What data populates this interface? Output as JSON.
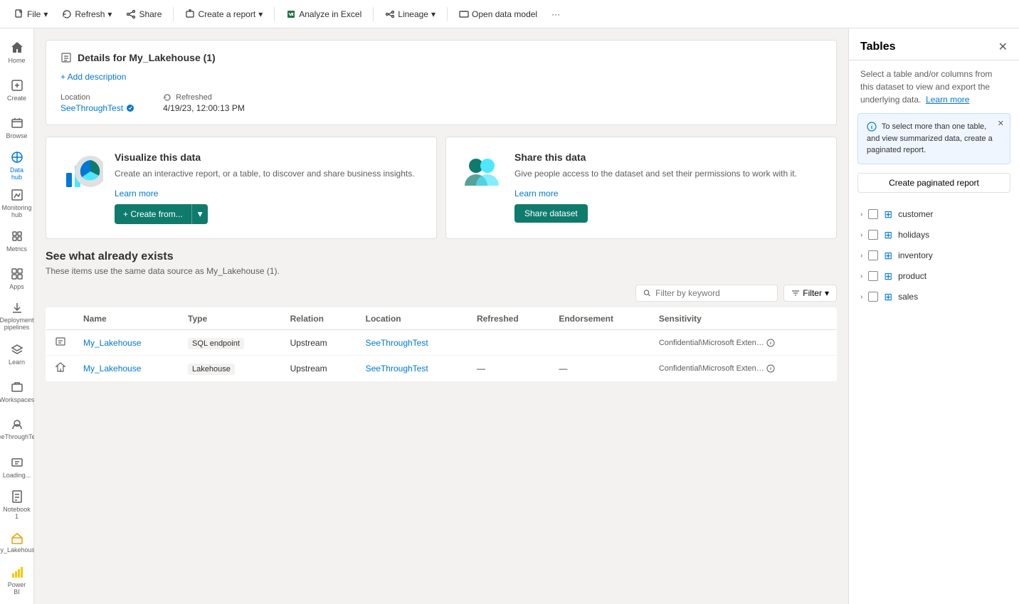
{
  "toolbar": {
    "file_label": "File",
    "refresh_label": "Refresh",
    "share_label": "Share",
    "create_report_label": "Create a report",
    "analyze_excel_label": "Analyze in Excel",
    "lineage_label": "Lineage",
    "open_data_model_label": "Open data model",
    "more_label": "···"
  },
  "sidebar": {
    "items": [
      {
        "id": "home",
        "label": "Home"
      },
      {
        "id": "create",
        "label": "Create"
      },
      {
        "id": "browse",
        "label": "Browse"
      },
      {
        "id": "datahub",
        "label": "Data hub",
        "active": true
      },
      {
        "id": "monitoring",
        "label": "Monitoring hub"
      },
      {
        "id": "metrics",
        "label": "Metrics"
      },
      {
        "id": "apps",
        "label": "Apps"
      },
      {
        "id": "deployment",
        "label": "Deployment pipelines"
      },
      {
        "id": "learn",
        "label": "Learn"
      },
      {
        "id": "workspaces",
        "label": "Workspaces"
      },
      {
        "id": "seethrough",
        "label": "SeeThroughTest"
      },
      {
        "id": "loading",
        "label": "Loading..."
      },
      {
        "id": "notebook1",
        "label": "Notebook 1"
      },
      {
        "id": "mylakehouse",
        "label": "My_Lakehouse"
      }
    ],
    "powerbi_label": "Power BI"
  },
  "details": {
    "title": "Details for My_Lakehouse (1)",
    "add_description": "+ Add description",
    "location_label": "Location",
    "location_value": "SeeThroughTest",
    "refreshed_label": "Refreshed",
    "refreshed_value": "4/19/23, 12:00:13 PM"
  },
  "action_cards": {
    "visualize": {
      "title": "Visualize this data",
      "description": "Create an interactive report, or a table, to discover and share business insights.",
      "learn_more": "Learn more",
      "create_button": "+ Create from...",
      "create_button_dropdown": "▾"
    },
    "share": {
      "title": "Share this data",
      "description": "Give people access to the dataset and set their permissions to work with it.",
      "learn_more": "Learn more",
      "share_button": "Share dataset"
    }
  },
  "existing_items": {
    "title": "See what already exists",
    "subtitle": "These items use the same data source as My_Lakehouse (1).",
    "filter_placeholder": "Filter by keyword",
    "filter_label": "Filter",
    "columns": [
      "Name",
      "Type",
      "Relation",
      "Location",
      "Refreshed",
      "Endorsement",
      "Sensitivity"
    ],
    "rows": [
      {
        "icon": "endpoint",
        "name": "My_Lakehouse",
        "type": "SQL endpoint",
        "relation": "Upstream",
        "location": "SeeThroughTest",
        "refreshed": "",
        "endorsement": "",
        "sensitivity": "Confidential\\Microsoft Exten…",
        "has_info": true
      },
      {
        "icon": "lakehouse",
        "name": "My_Lakehouse",
        "type": "Lakehouse",
        "relation": "Upstream",
        "location": "SeeThroughTest",
        "refreshed": "—",
        "endorsement": "—",
        "sensitivity": "Confidential\\Microsoft Exten…",
        "has_info": true
      }
    ]
  },
  "right_panel": {
    "title": "Tables",
    "description": "Select a table and/or columns from this dataset to view and export the underlying data.",
    "learn_more": "Learn more",
    "info_banner": "To select more than one table, and view summarized data, create a paginated report.",
    "create_paged_label": "Create paginated report",
    "tables": [
      {
        "name": "customer"
      },
      {
        "name": "holidays"
      },
      {
        "name": "inventory"
      },
      {
        "name": "product"
      },
      {
        "name": "sales"
      }
    ]
  }
}
